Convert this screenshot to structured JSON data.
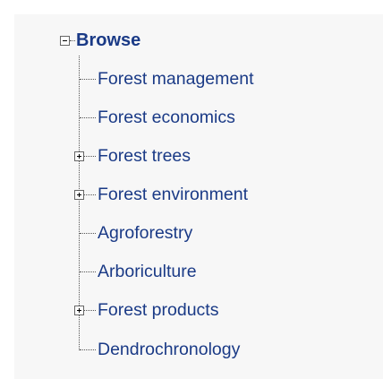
{
  "tree": {
    "root": {
      "label": "Browse",
      "expanded": true,
      "toggle_icon": "minus-box-icon"
    },
    "items": [
      {
        "label": "Forest management",
        "expandable": false
      },
      {
        "label": "Forest economics",
        "expandable": false
      },
      {
        "label": "Forest trees",
        "expandable": true,
        "toggle_icon": "plus-box-icon"
      },
      {
        "label": "Forest environment",
        "expandable": true,
        "toggle_icon": "plus-box-icon"
      },
      {
        "label": "Agroforestry",
        "expandable": false
      },
      {
        "label": "Arboriculture",
        "expandable": false
      },
      {
        "label": "Forest products",
        "expandable": true,
        "toggle_icon": "plus-box-icon"
      },
      {
        "label": "Dendrochronology",
        "expandable": false
      }
    ],
    "link_color": "#1a3a86"
  }
}
